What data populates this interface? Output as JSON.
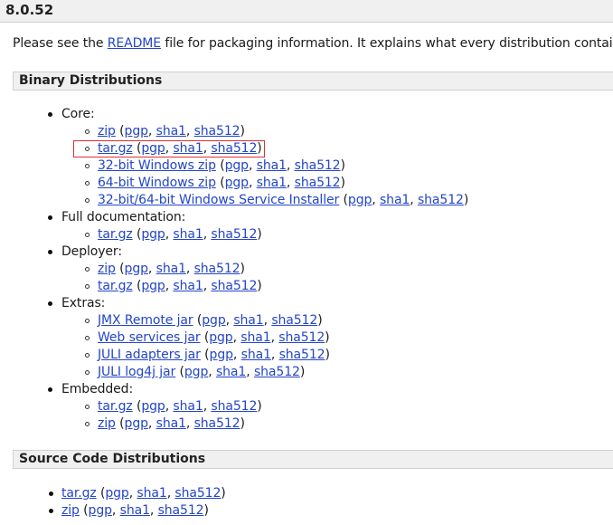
{
  "version": "8.0.52",
  "intro": {
    "before": "Please see the ",
    "link": "README",
    "after": " file for packaging information. It explains what every distribution contains."
  },
  "binary": {
    "title": "Binary Distributions",
    "core": {
      "label": "Core:",
      "items": [
        {
          "name": "zip",
          "sigs": [
            "pgp",
            "sha1",
            "sha512"
          ]
        },
        {
          "name": "tar.gz",
          "sigs": [
            "pgp",
            "sha1",
            "sha512"
          ],
          "highlighted": true
        },
        {
          "name": "32-bit Windows zip",
          "sigs": [
            "pgp",
            "sha1",
            "sha512"
          ]
        },
        {
          "name": "64-bit Windows zip",
          "sigs": [
            "pgp",
            "sha1",
            "sha512"
          ]
        },
        {
          "name": "32-bit/64-bit Windows Service Installer",
          "sigs": [
            "pgp",
            "sha1",
            "sha512"
          ]
        }
      ]
    },
    "docs": {
      "label": "Full documentation:",
      "items": [
        {
          "name": "tar.gz",
          "sigs": [
            "pgp",
            "sha1",
            "sha512"
          ]
        }
      ]
    },
    "deployer": {
      "label": "Deployer:",
      "items": [
        {
          "name": "zip",
          "sigs": [
            "pgp",
            "sha1",
            "sha512"
          ]
        },
        {
          "name": "tar.gz",
          "sigs": [
            "pgp",
            "sha1",
            "sha512"
          ]
        }
      ]
    },
    "extras": {
      "label": "Extras:",
      "items": [
        {
          "name": "JMX Remote jar",
          "sigs": [
            "pgp",
            "sha1",
            "sha512"
          ]
        },
        {
          "name": "Web services jar",
          "sigs": [
            "pgp",
            "sha1",
            "sha512"
          ]
        },
        {
          "name": "JULI adapters jar",
          "sigs": [
            "pgp",
            "sha1",
            "sha512"
          ]
        },
        {
          "name": "JULI log4j jar",
          "sigs": [
            "pgp",
            "sha1",
            "sha512"
          ]
        }
      ]
    },
    "embedded": {
      "label": "Embedded:",
      "items": [
        {
          "name": "tar.gz",
          "sigs": [
            "pgp",
            "sha1",
            "sha512"
          ]
        },
        {
          "name": "zip",
          "sigs": [
            "pgp",
            "sha1",
            "sha512"
          ]
        }
      ]
    }
  },
  "source": {
    "title": "Source Code Distributions",
    "items": [
      {
        "name": "tar.gz",
        "sigs": [
          "pgp",
          "sha1",
          "sha512"
        ]
      },
      {
        "name": "zip",
        "sigs": [
          "pgp",
          "sha1",
          "sha512"
        ]
      }
    ]
  }
}
